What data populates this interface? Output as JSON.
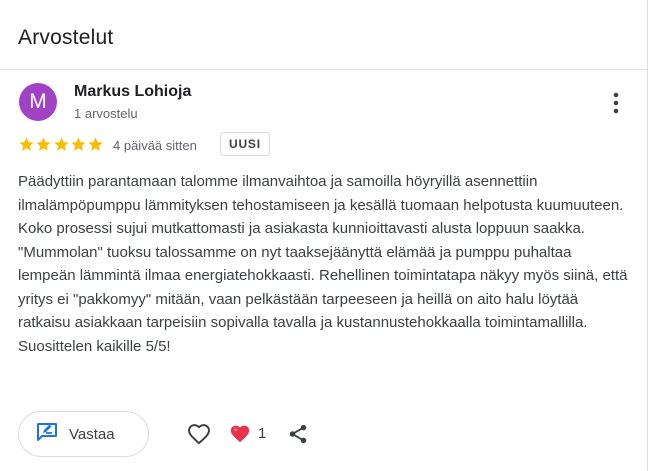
{
  "section": {
    "title": "Arvostelut"
  },
  "review": {
    "avatar_letter": "M",
    "avatar_color": "#a142c6",
    "author": "Markus Lohioja",
    "author_review_count": "1 arvostelu",
    "rating": 5,
    "rating_max": 5,
    "star_color": "#fbbc04",
    "time": "4 päivää sitten",
    "badge": "UUSI",
    "text": "Päädyttiin parantamaan talomme ilmanvaihtoa ja samoilla höyryillä asennettiin ilmalämpöpumppu lämmityksen tehostamiseen ja kesällä tuomaan helpotusta kuumuuteen. Koko prosessi sujui mutkattomasti ja asiakasta kunnioittavasti alusta loppuun saakka. \"Mummolan\" tuoksu talossamme on nyt taaksejäänyttä elämää ja pumppu puhaltaa lempeän lämmintä ilmaa energiatehokkaasti. Rehellinen toimintatapa näkyy myös siinä, että yritys ei \"pakkomyy\" mitään, vaan pelkästään tarpeeseen ja heillä on aito halu löytää ratkaisu asiakkaan tarpeisiin sopivalla tavalla ja kustannustehokkaalla toimintamallilla. Suosittelen kaikille 5/5!",
    "actions": {
      "reply_label": "Vastaa",
      "reply_icon": "reply-edit-icon",
      "like_icon": "heart-outline-icon",
      "reaction_icon": "heart-emoji-icon",
      "reaction_count": "1",
      "share_icon": "share-icon",
      "more_icon": "more-vert-icon"
    },
    "accent_color": "#1a73e8",
    "reaction_color": "#e8334a"
  }
}
